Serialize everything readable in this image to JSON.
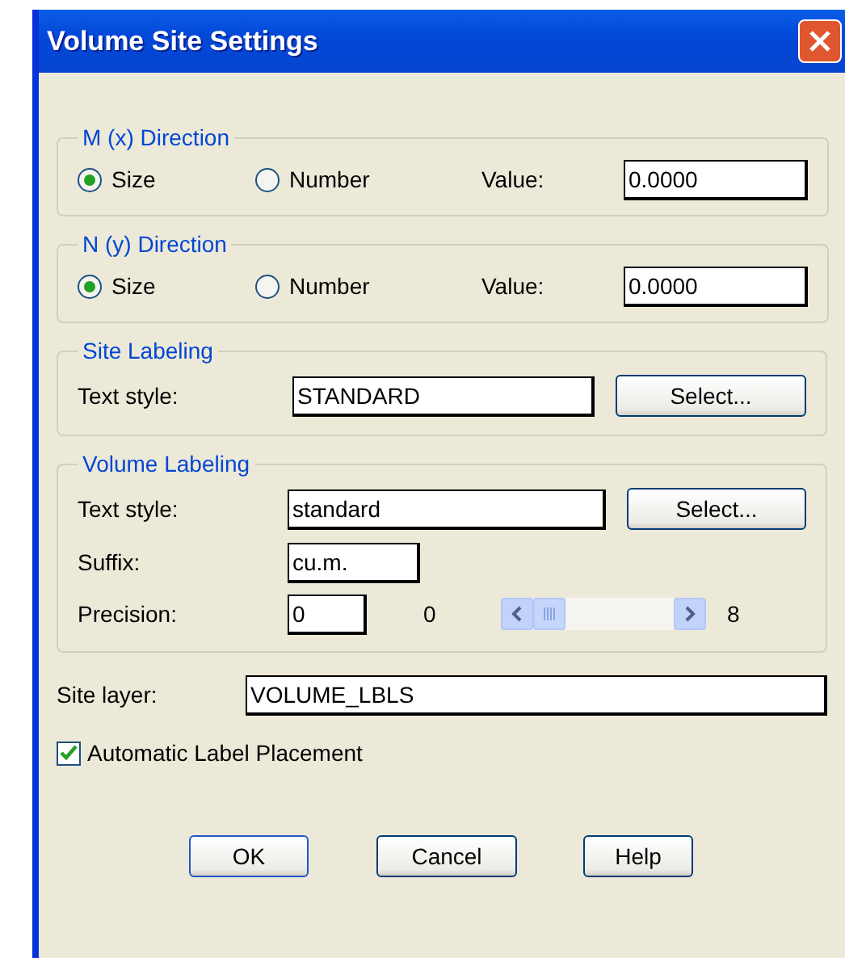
{
  "window": {
    "title": "Volume Site Settings"
  },
  "m_direction": {
    "title": "M (x) Direction",
    "options": [
      {
        "label": "Size",
        "selected": true
      },
      {
        "label": "Number",
        "selected": false
      }
    ],
    "value_label": "Value:",
    "value": "0.0000"
  },
  "n_direction": {
    "title": "N (y) Direction",
    "options": [
      {
        "label": "Size",
        "selected": true
      },
      {
        "label": "Number",
        "selected": false
      }
    ],
    "value_label": "Value:",
    "value": "0.0000"
  },
  "site_labeling": {
    "title": "Site Labeling",
    "text_style_label": "Text style:",
    "text_style": "STANDARD",
    "select_button": "Select..."
  },
  "volume_labeling": {
    "title": "Volume Labeling",
    "text_style_label": "Text style:",
    "text_style": "standard",
    "select_button": "Select...",
    "suffix_label": "Suffix:",
    "suffix": "cu.m.",
    "precision_label": "Precision:",
    "precision": "0",
    "precision_min": "0",
    "precision_max": "8",
    "precision_slider": {
      "level": 0
    }
  },
  "site_layer": {
    "label": "Site layer:",
    "value": "VOLUME_LBLS"
  },
  "auto_placement": {
    "label": "Automatic Label Placement",
    "checked": true
  },
  "buttons": [
    {
      "kind": "ok",
      "label": "OK"
    },
    {
      "kind": "cancel",
      "label": "Cancel"
    },
    {
      "kind": "help",
      "label": "Help"
    }
  ]
}
